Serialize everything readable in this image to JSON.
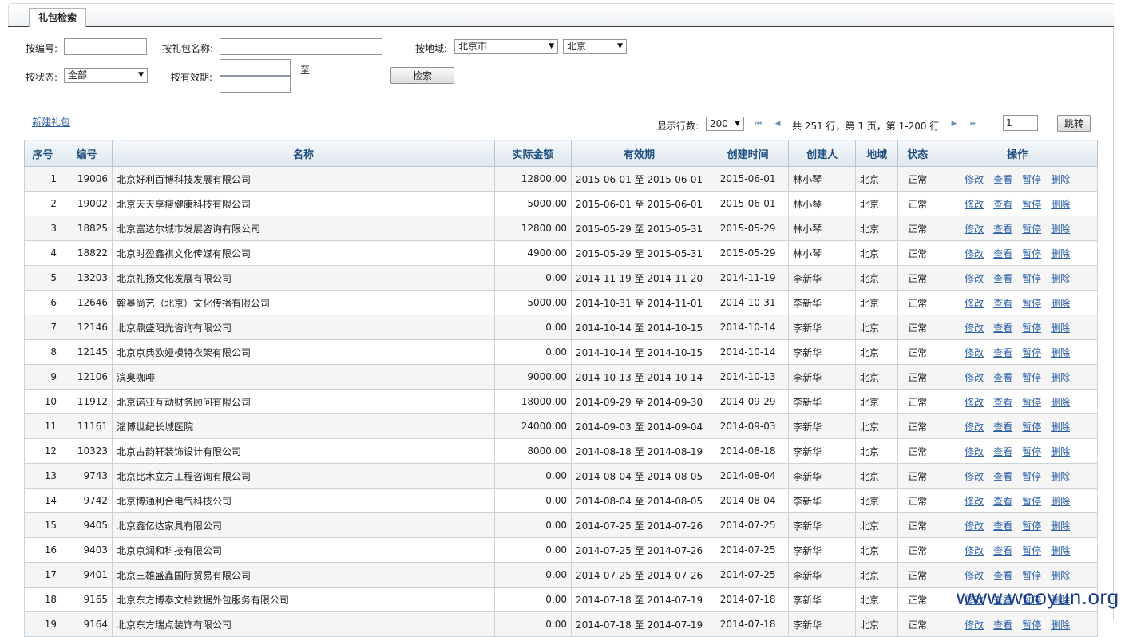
{
  "tab_title": "礼包检索",
  "form": {
    "code_label": "按编号:",
    "name_label": "按礼包名称:",
    "region_label": "按地域:",
    "region_province": "北京市",
    "region_city": "北京",
    "status_label": "按状态:",
    "status_value": "全部",
    "validity_label": "按有效期:",
    "to_label": "至",
    "search_button": "检索"
  },
  "toolbar": {
    "new_link": "新建礼包",
    "page_size_label": "显示行数:",
    "page_size": "200",
    "summary": "共 251 行，第 1 页，第 1-200 行",
    "page_input": "1",
    "jump_button": "跳转"
  },
  "table": {
    "headers": [
      "序号",
      "编号",
      "名称",
      "实际金额",
      "有效期",
      "创建时间",
      "创建人",
      "地域",
      "状态",
      "操作"
    ],
    "actions": [
      "修改",
      "查看",
      "暂停",
      "删除"
    ],
    "rows": [
      {
        "no": "1",
        "code": "19006",
        "name": "北京好利百博科技发展有限公司",
        "amount": "12800.00",
        "valid": "2015-06-01 至 2015-06-01",
        "created": "2015-06-01",
        "creator": "林小琴",
        "region": "北京",
        "status": "正常"
      },
      {
        "no": "2",
        "code": "19002",
        "name": "北京天天享瘦健康科技有限公司",
        "amount": "5000.00",
        "valid": "2015-06-01 至 2015-06-01",
        "created": "2015-06-01",
        "creator": "林小琴",
        "region": "北京",
        "status": "正常"
      },
      {
        "no": "3",
        "code": "18825",
        "name": "北京富达尔城市发展咨询有限公司",
        "amount": "12800.00",
        "valid": "2015-05-29 至 2015-05-31",
        "created": "2015-05-29",
        "creator": "林小琴",
        "region": "北京",
        "status": "正常"
      },
      {
        "no": "4",
        "code": "18822",
        "name": "北京时盈鑫祺文化传媒有限公司",
        "amount": "4900.00",
        "valid": "2015-05-29 至 2015-05-31",
        "created": "2015-05-29",
        "creator": "林小琴",
        "region": "北京",
        "status": "正常"
      },
      {
        "no": "5",
        "code": "13203",
        "name": "北京礼扬文化发展有限公司",
        "amount": "0.00",
        "valid": "2014-11-19 至 2014-11-20",
        "created": "2014-11-19",
        "creator": "李新华",
        "region": "北京",
        "status": "正常"
      },
      {
        "no": "6",
        "code": "12646",
        "name": "翰墨尚艺（北京）文化传播有限公司",
        "amount": "5000.00",
        "valid": "2014-10-31 至 2014-11-01",
        "created": "2014-10-31",
        "creator": "李新华",
        "region": "北京",
        "status": "正常"
      },
      {
        "no": "7",
        "code": "12146",
        "name": "北京鼎盛阳光咨询有限公司",
        "amount": "0.00",
        "valid": "2014-10-14 至 2014-10-15",
        "created": "2014-10-14",
        "creator": "李新华",
        "region": "北京",
        "status": "正常"
      },
      {
        "no": "8",
        "code": "12145",
        "name": "北京京典欧娅模特衣架有限公司",
        "amount": "0.00",
        "valid": "2014-10-14 至 2014-10-15",
        "created": "2014-10-14",
        "creator": "李新华",
        "region": "北京",
        "status": "正常"
      },
      {
        "no": "9",
        "code": "12106",
        "name": "滨奥咖啡",
        "amount": "9000.00",
        "valid": "2014-10-13 至 2014-10-14",
        "created": "2014-10-13",
        "creator": "李新华",
        "region": "北京",
        "status": "正常"
      },
      {
        "no": "10",
        "code": "11912",
        "name": "北京诺亚互动财务顾问有限公司",
        "amount": "18000.00",
        "valid": "2014-09-29 至 2014-09-30",
        "created": "2014-09-29",
        "creator": "李新华",
        "region": "北京",
        "status": "正常"
      },
      {
        "no": "11",
        "code": "11161",
        "name": "淄博世纪长城医院",
        "amount": "24000.00",
        "valid": "2014-09-03 至 2014-09-04",
        "created": "2014-09-03",
        "creator": "李新华",
        "region": "北京",
        "status": "正常"
      },
      {
        "no": "12",
        "code": "10323",
        "name": "北京古韵轩装饰设计有限公司",
        "amount": "8000.00",
        "valid": "2014-08-18 至 2014-08-19",
        "created": "2014-08-18",
        "creator": "李新华",
        "region": "北京",
        "status": "正常"
      },
      {
        "no": "13",
        "code": "9743",
        "name": "北京比木立方工程咨询有限公司",
        "amount": "0.00",
        "valid": "2014-08-04 至 2014-08-05",
        "created": "2014-08-04",
        "creator": "李新华",
        "region": "北京",
        "status": "正常"
      },
      {
        "no": "14",
        "code": "9742",
        "name": "北京博通利合电气科技公司",
        "amount": "0.00",
        "valid": "2014-08-04 至 2014-08-05",
        "created": "2014-08-04",
        "creator": "李新华",
        "region": "北京",
        "status": "正常"
      },
      {
        "no": "15",
        "code": "9405",
        "name": "北京鑫亿达家具有限公司",
        "amount": "0.00",
        "valid": "2014-07-25 至 2014-07-26",
        "created": "2014-07-25",
        "creator": "李新华",
        "region": "北京",
        "status": "正常"
      },
      {
        "no": "16",
        "code": "9403",
        "name": "北京京润和科技有限公司",
        "amount": "0.00",
        "valid": "2014-07-25 至 2014-07-26",
        "created": "2014-07-25",
        "creator": "李新华",
        "region": "北京",
        "status": "正常"
      },
      {
        "no": "17",
        "code": "9401",
        "name": "北京三雄盛鑫国际贸易有限公司",
        "amount": "0.00",
        "valid": "2014-07-25 至 2014-07-26",
        "created": "2014-07-25",
        "creator": "李新华",
        "region": "北京",
        "status": "正常"
      },
      {
        "no": "18",
        "code": "9165",
        "name": "北京东方博泰文档数据外包服务有限公司",
        "amount": "0.00",
        "valid": "2014-07-18 至 2014-07-19",
        "created": "2014-07-18",
        "creator": "李新华",
        "region": "北京",
        "status": "正常"
      },
      {
        "no": "19",
        "code": "9164",
        "name": "北京东方瑞点装饰有限公司",
        "amount": "0.00",
        "valid": "2014-07-18 至 2014-07-19",
        "created": "2014-07-18",
        "creator": "李新华",
        "region": "北京",
        "status": "正常"
      }
    ]
  },
  "watermark": "www.wooyun.org"
}
